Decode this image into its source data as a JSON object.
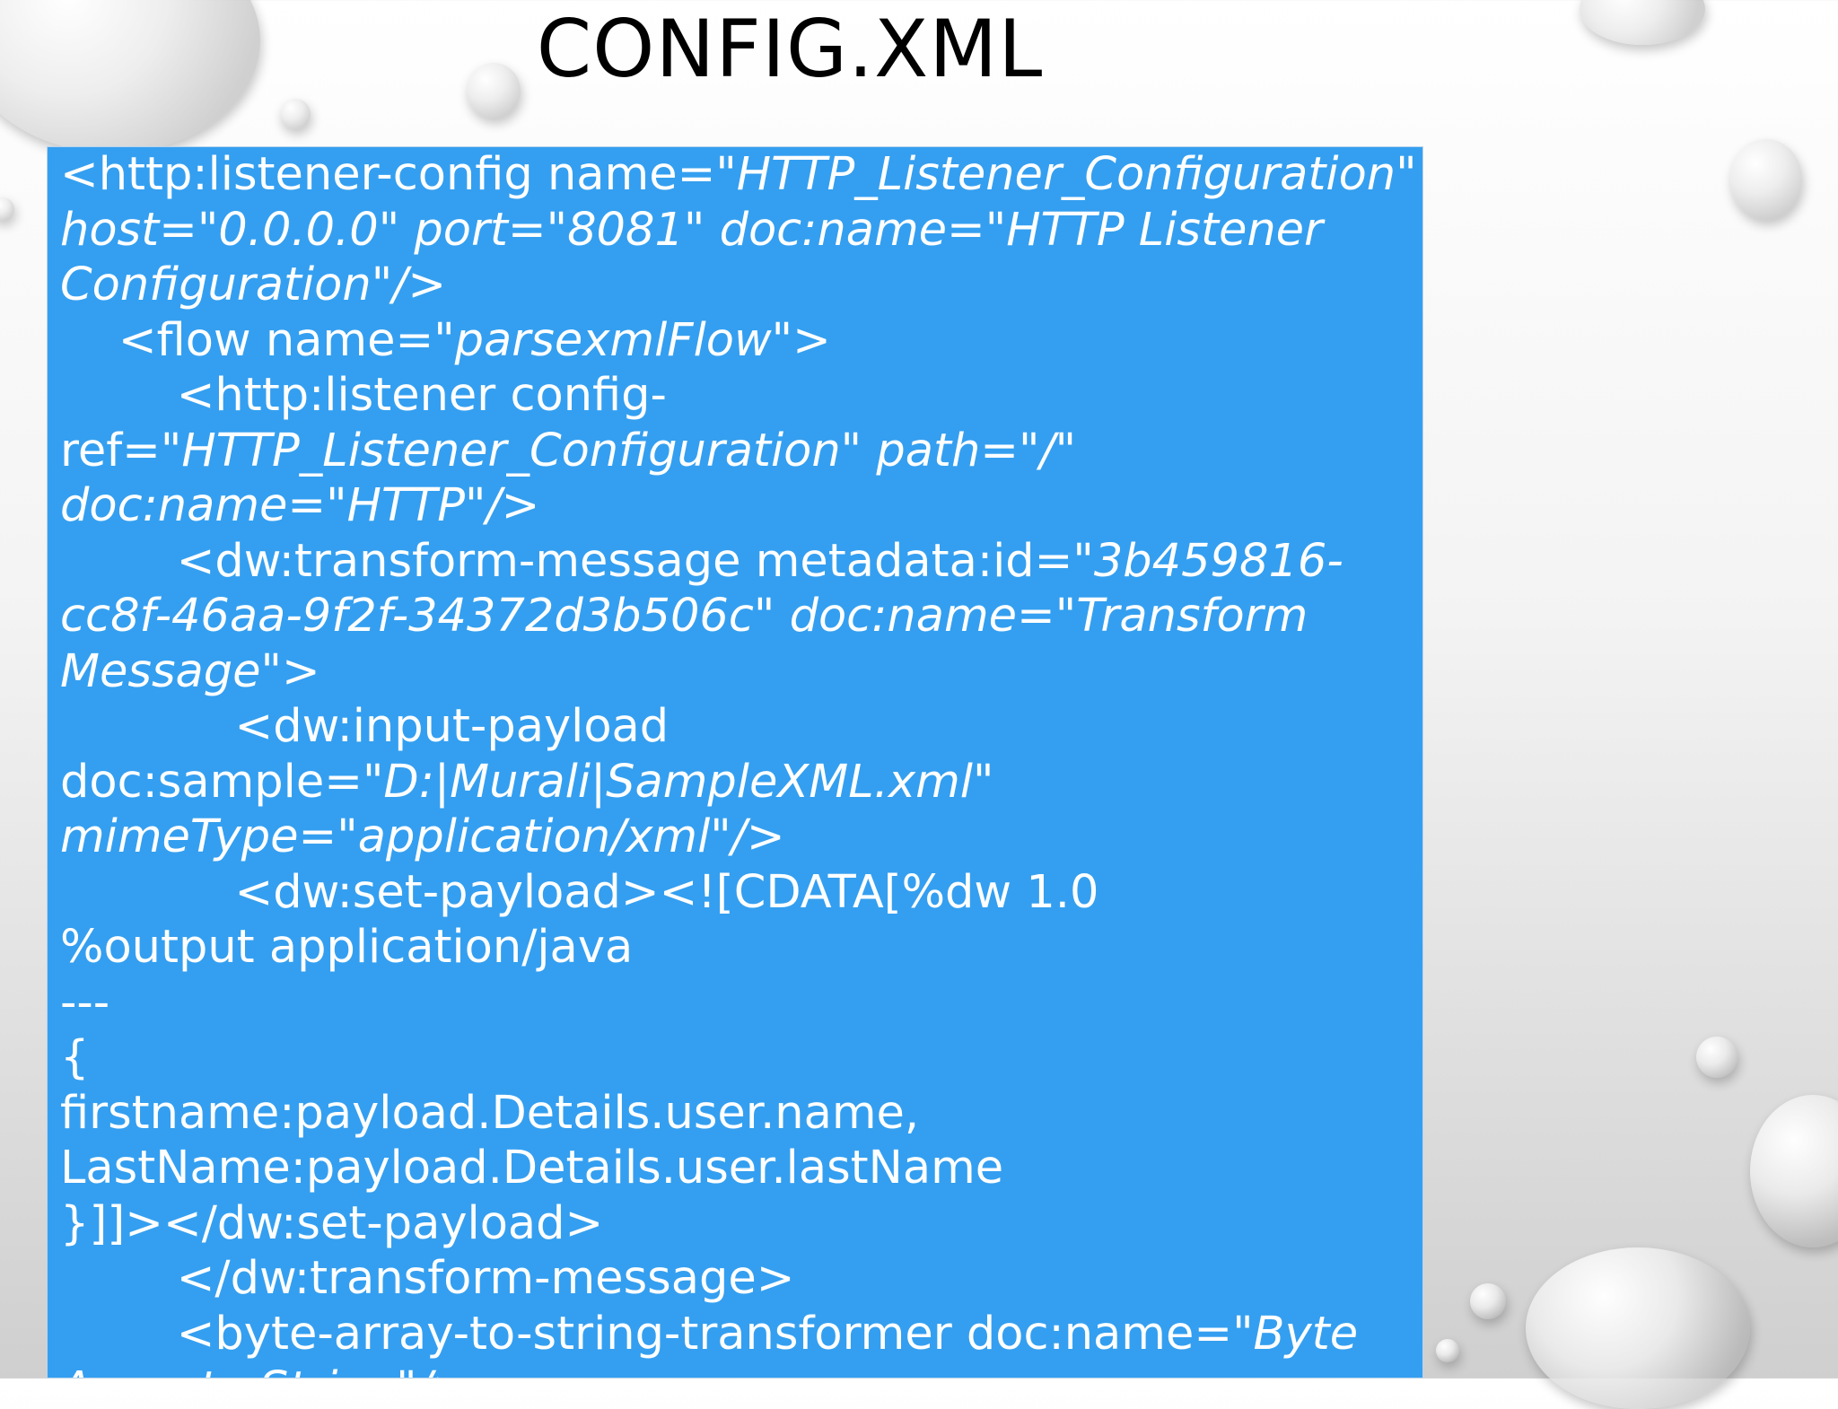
{
  "slide": {
    "title": "CONFIG.XML"
  },
  "code": [
    [
      {
        "t": "<http:listener-config name=",
        "i": false
      },
      {
        "t": "\"HTTP_Listener_Configuration\"",
        "i": true
      }
    ],
    [
      {
        "t": "host=\"0.0.0.0\" port=\"8081\" doc:name=\"HTTP Listener",
        "i": true
      }
    ],
    [
      {
        "t": "Configuration\"/>",
        "i": true
      }
    ],
    [
      {
        "t": "    <flow name=",
        "i": false
      },
      {
        "t": "\"parsexmlFlow\"",
        "i": true
      },
      {
        "t": ">",
        "i": false
      }
    ],
    [
      {
        "t": "        <http:listener config-",
        "i": false
      }
    ],
    [
      {
        "t": "ref=",
        "i": false
      },
      {
        "t": "\"HTTP_Listener_Configuration\" path=\"/\"",
        "i": true
      }
    ],
    [
      {
        "t": "doc:name=\"HTTP\"/>",
        "i": true
      }
    ],
    [
      {
        "t": "        <dw:transform-message metadata:id=",
        "i": false
      },
      {
        "t": "\"3b459816-",
        "i": true
      }
    ],
    [
      {
        "t": "cc8f-46aa-9f2f-34372d3b506c\" doc:name=\"Transform",
        "i": true
      }
    ],
    [
      {
        "t": "Message\">",
        "i": true
      }
    ],
    [
      {
        "t": "            <dw:input-payload",
        "i": false
      }
    ],
    [
      {
        "t": "doc:sample=",
        "i": false
      },
      {
        "t": "\"D:|Murali|SampleXML.xml\"",
        "i": true
      }
    ],
    [
      {
        "t": "mimeType=\"application/xml\"/>",
        "i": true
      }
    ],
    [
      {
        "t": "            <dw:set-payload><![CDATA[%dw 1.0",
        "i": false
      }
    ],
    [
      {
        "t": "%output application/java",
        "i": false
      }
    ],
    [
      {
        "t": "---",
        "i": false
      }
    ],
    [
      {
        "t": "{",
        "i": false
      }
    ],
    [
      {
        "t": "firstname:payload.Details.user.name,",
        "i": false
      }
    ],
    [
      {
        "t": "LastName:payload.Details.user.lastName",
        "i": false
      }
    ],
    [
      {
        "t": "}]]></dw:set-payload>",
        "i": false
      }
    ],
    [
      {
        "t": "        </dw:transform-message>",
        "i": false
      }
    ],
    [
      {
        "t": "        <byte-array-to-string-transformer doc:name=",
        "i": false
      },
      {
        "t": "\"Byte",
        "i": true
      }
    ],
    [
      {
        "t": "Array to String\"/>",
        "i": true
      }
    ]
  ]
}
